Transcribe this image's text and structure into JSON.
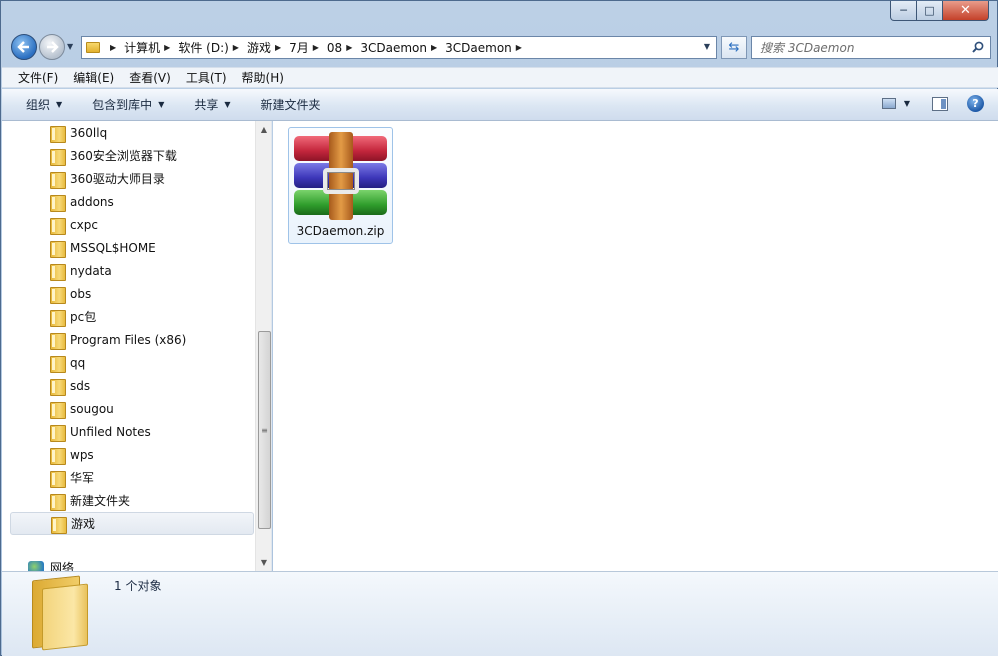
{
  "window": {
    "caption_buttons": {
      "minimize": "─",
      "maximize": "□",
      "close": "✕"
    }
  },
  "address": {
    "breadcrumbs": [
      "计算机",
      "软件 (D:)",
      "游戏",
      "7月",
      "08",
      "3CDaemon",
      "3CDaemon"
    ]
  },
  "search": {
    "placeholder": "搜索 3CDaemon"
  },
  "menubar": {
    "items": [
      "文件(F)",
      "编辑(E)",
      "查看(V)",
      "工具(T)",
      "帮助(H)"
    ]
  },
  "toolbar": {
    "organize": "组织",
    "include_in_library": "包含到库中",
    "share": "共享",
    "new_folder": "新建文件夹"
  },
  "navpane": {
    "items": [
      "360llq",
      "360安全浏览器下载",
      "360驱动大师目录",
      "addons",
      "cxpc",
      "MSSQL$HOME",
      "nydata",
      "obs",
      "pc包",
      "Program Files (x86)",
      "qq",
      "sds",
      "sougou",
      "Unfiled Notes",
      "wps",
      "华军",
      "新建文件夹",
      "游戏"
    ],
    "selected_index": 17,
    "network_label": "网络"
  },
  "content": {
    "files": [
      {
        "name": "3CDaemon.zip",
        "icon": "winrar-archive-icon"
      }
    ]
  },
  "details": {
    "count_text": "1 个对象"
  }
}
